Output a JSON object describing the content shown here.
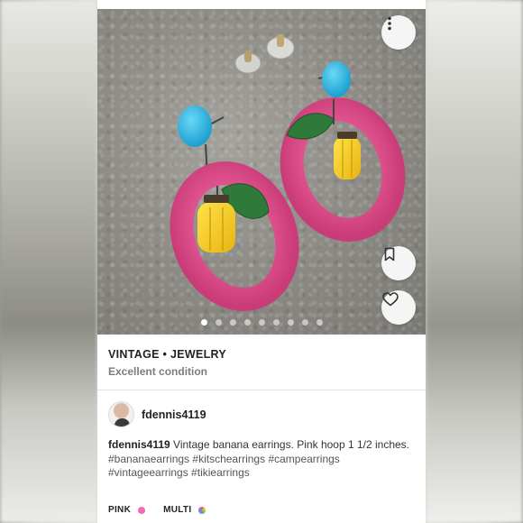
{
  "listing": {
    "brand_line": "VINTAGE • JEWELRY",
    "condition": "Excellent condition"
  },
  "carousel": {
    "total_images": 9,
    "active_index": 0
  },
  "actions": {
    "more_icon": "more-vertical-icon",
    "bookmark_icon": "bookmark-icon",
    "like_icon": "heart-icon"
  },
  "seller": {
    "username": "fdennis4119"
  },
  "description": {
    "author": "fdennis4119",
    "text": "Vintage banana earrings. Pink hoop 1 1/2 inches.",
    "hashtags_line1": "#bananaearrings #kitschearrings #campearrings",
    "hashtags_line2": "#vintageearrings #tikiearrings"
  },
  "colors": [
    {
      "label": "PINK",
      "hex": "#f06cb4"
    },
    {
      "label": "MULTI",
      "hex": "multi"
    }
  ]
}
